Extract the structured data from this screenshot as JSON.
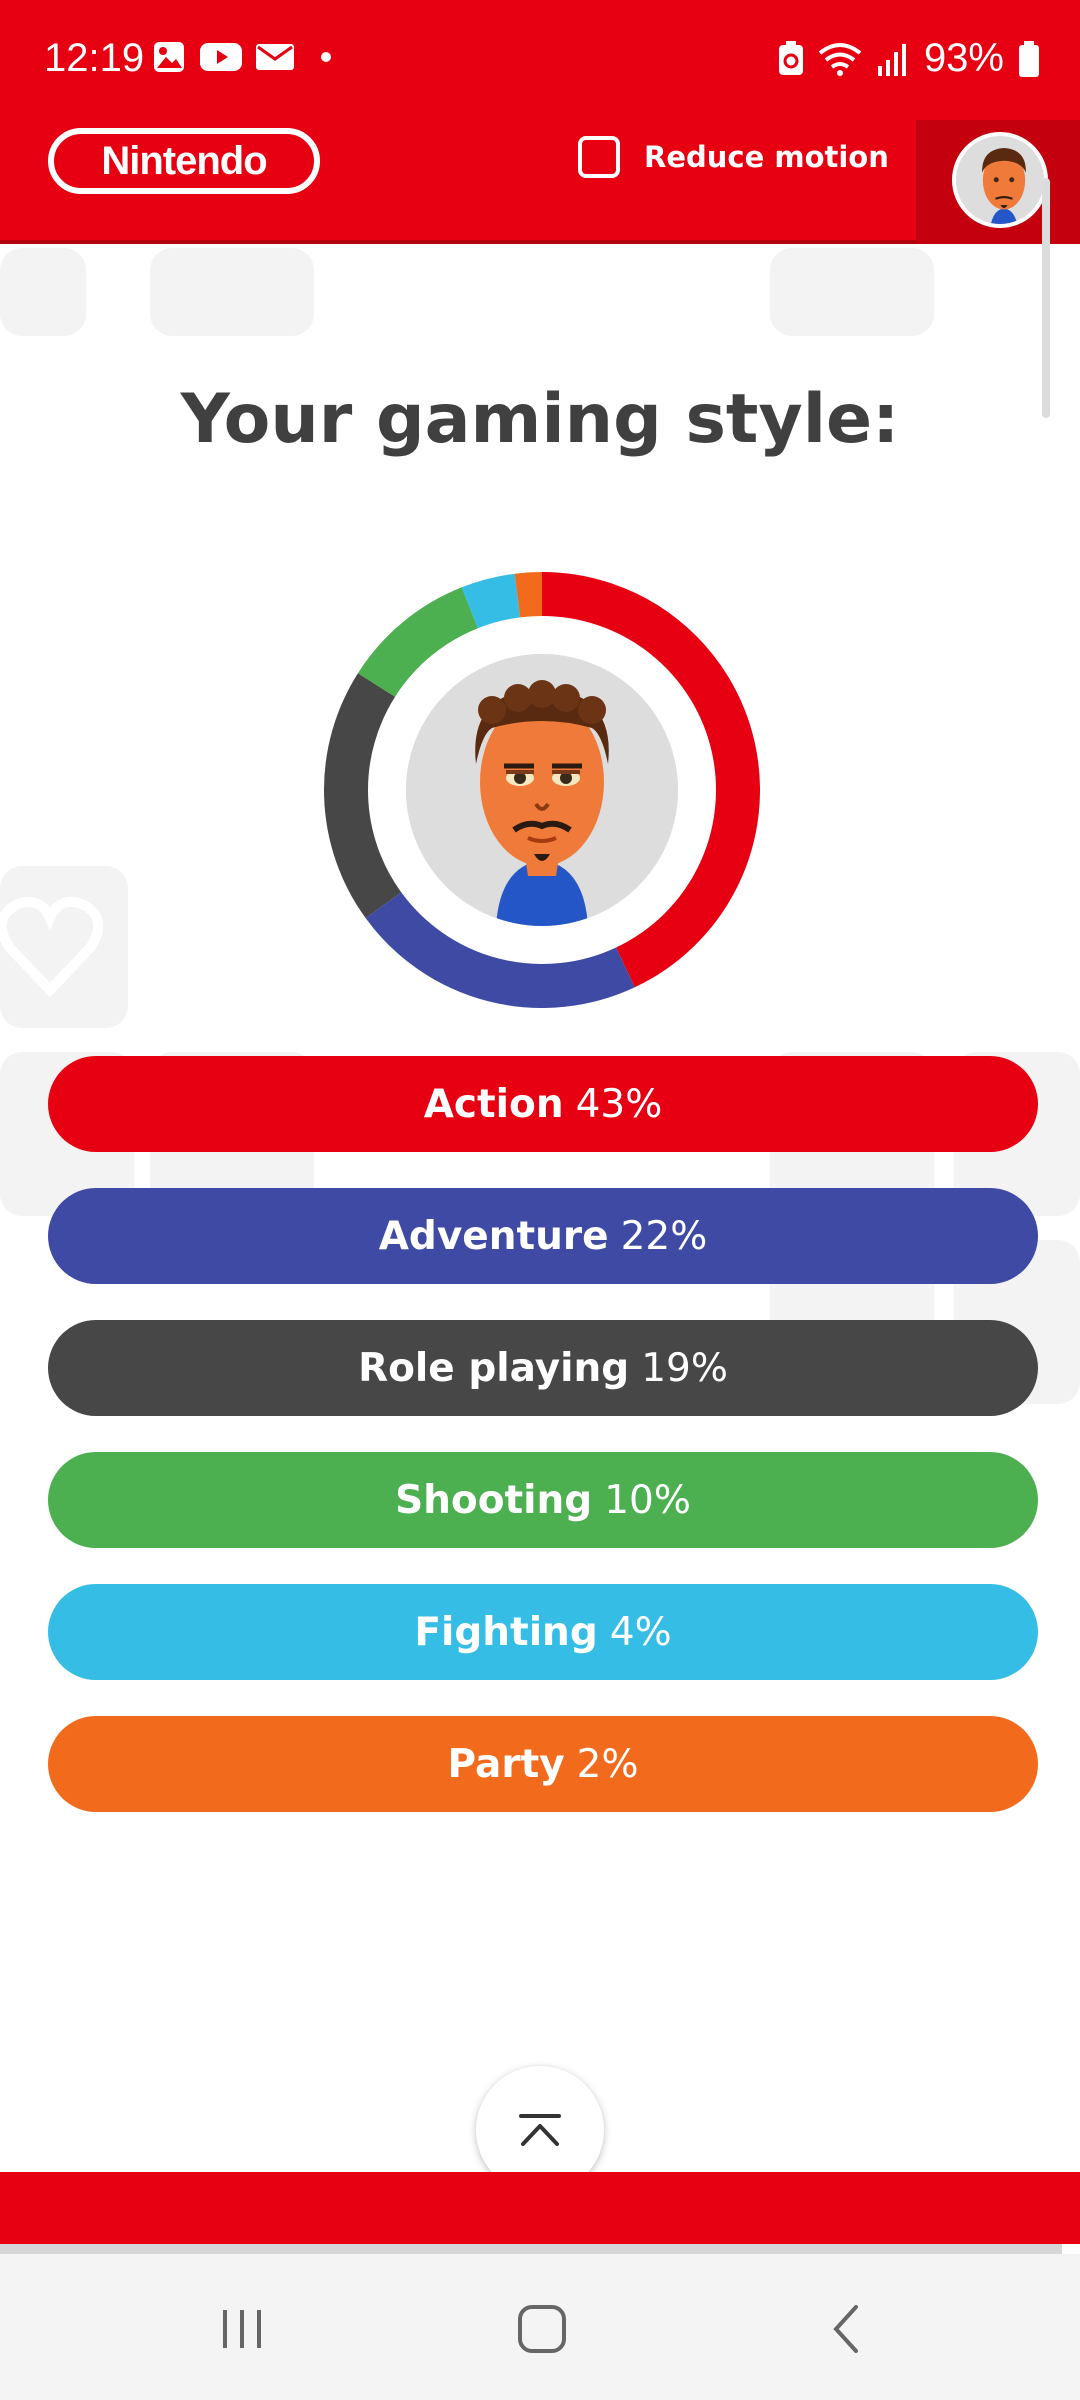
{
  "status_bar": {
    "time": "12:19",
    "battery": "93%",
    "icons": [
      "gallery-icon",
      "youtube-icon",
      "mail-icon",
      "dot-icon",
      "battery-saver-icon",
      "wifi-icon",
      "signal-icon",
      "battery-icon"
    ]
  },
  "header": {
    "logo": "Nintendo",
    "reduce_motion_label": "Reduce motion",
    "reduce_motion_checked": false
  },
  "main": {
    "title": "Your gaming style:"
  },
  "styles": [
    {
      "name": "Action",
      "pct": "43%",
      "value": 43,
      "color": "#e60012"
    },
    {
      "name": "Adventure",
      "pct": "22%",
      "value": 22,
      "color": "#3f4aa4"
    },
    {
      "name": "Role playing",
      "pct": "19%",
      "value": 19,
      "color": "#474747"
    },
    {
      "name": "Shooting",
      "pct": "10%",
      "value": 10,
      "color": "#4caf50"
    },
    {
      "name": "Fighting",
      "pct": "4%",
      "value": 4,
      "color": "#36bde6"
    },
    {
      "name": "Party",
      "pct": "2%",
      "value": 2,
      "color": "#f26b1d"
    }
  ],
  "chart_data": {
    "type": "pie",
    "categories": [
      "Action",
      "Adventure",
      "Role playing",
      "Shooting",
      "Fighting",
      "Party"
    ],
    "values": [
      43,
      22,
      19,
      10,
      4,
      2
    ]
  },
  "colors": {
    "brand_red": "#e60012",
    "title_gray": "#404040"
  }
}
